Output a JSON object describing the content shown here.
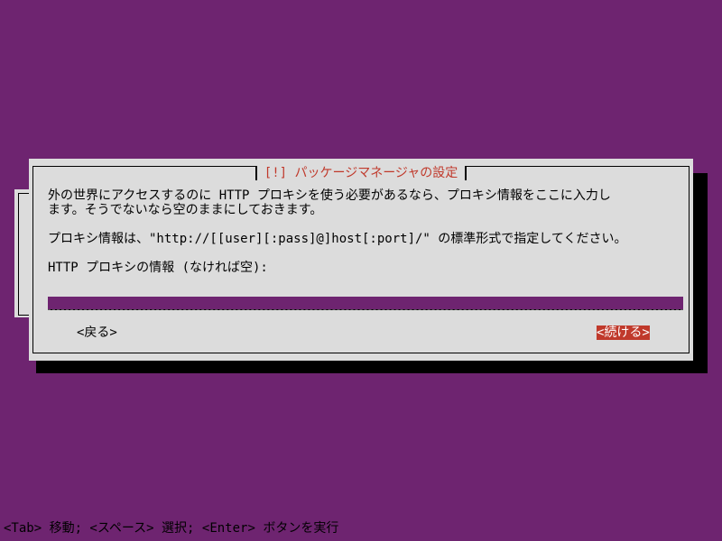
{
  "dialog": {
    "title": "[!] パッケージマネージャの設定",
    "description_line1": "外の世界にアクセスするのに HTTP プロキシを使う必要があるなら、プロキシ情報をここに入力し",
    "description_line2": "ます。そうでないなら空のままにしておきます。",
    "format_line": "プロキシ情報は、\"http://[[user][:pass]@]host[:port]/\" の標準形式で指定してください。",
    "field_label": "HTTP プロキシの情報 (なければ空):",
    "proxy_value": "",
    "back_label": "<戻る>",
    "continue_label": "<続ける>"
  },
  "statusbar": {
    "text": "<Tab> 移動; <スペース> 選択; <Enter> ボタンを実行"
  },
  "colors": {
    "background": "#6e2470",
    "dialog": "#dcdcdc",
    "accent": "#c0392b"
  }
}
